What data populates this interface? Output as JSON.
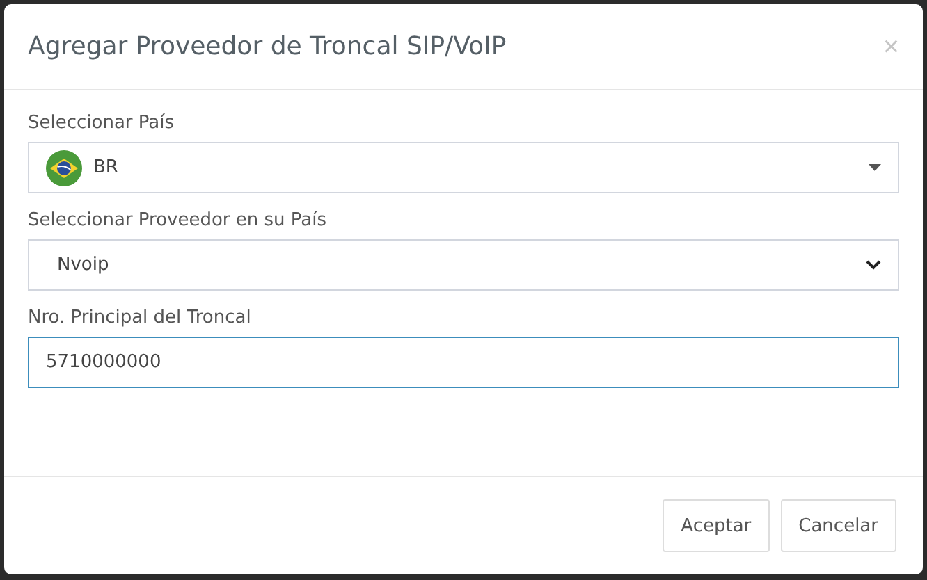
{
  "dialog": {
    "title": "Agregar Proveedor de Troncal SIP/VoIP",
    "close": "×"
  },
  "fields": [
    {
      "kind": "flag-select",
      "label": "Seleccionar País",
      "value": "BR",
      "focused": false
    },
    {
      "kind": "select",
      "label": "Seleccionar Proveedor en su País",
      "value": "Nvoip",
      "focused": false
    },
    {
      "kind": "input",
      "label": "Nro. Principal del Troncal",
      "value": "5710000000",
      "focused": true
    }
  ],
  "buttons": [
    "Aceptar",
    "Cancelar"
  ]
}
